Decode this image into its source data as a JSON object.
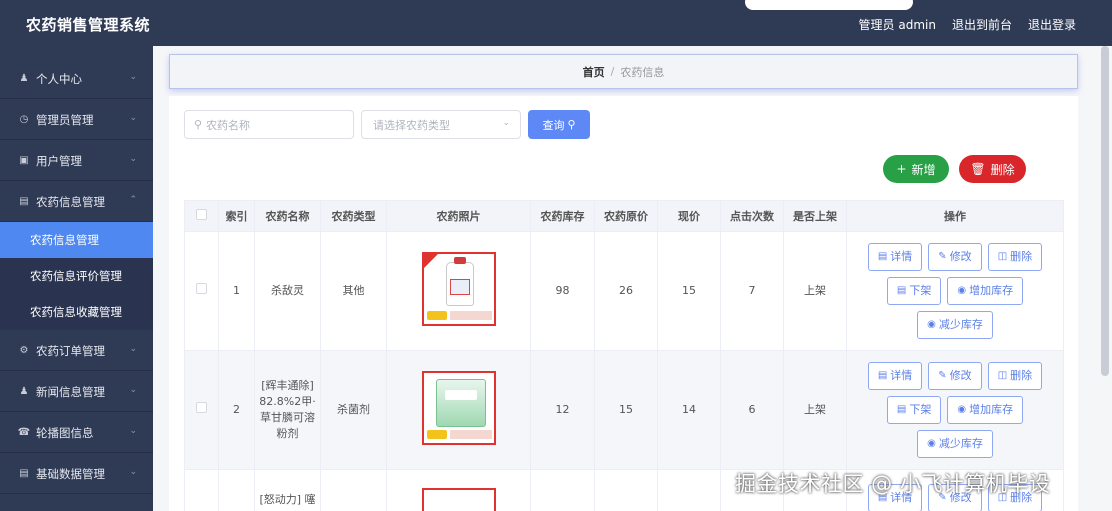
{
  "app": {
    "title": "农药销售管理系统"
  },
  "header": {
    "user_label": "管理员 admin",
    "links": [
      "退出到前台",
      "退出登录"
    ]
  },
  "sidebar": {
    "items": [
      {
        "label": "个人中心",
        "icon": "person-icon"
      },
      {
        "label": "管理员管理",
        "icon": "clock-icon"
      },
      {
        "label": "用户管理",
        "icon": "users-icon"
      },
      {
        "label": "农药信息管理",
        "icon": "doc-icon",
        "expanded": true,
        "children": [
          "农药信息管理",
          "农药信息评价管理",
          "农药信息收藏管理"
        ],
        "active_child": 0
      },
      {
        "label": "农药订单管理",
        "icon": "gear-icon"
      },
      {
        "label": "新闻信息管理",
        "icon": "person-icon"
      },
      {
        "label": "轮播图信息",
        "icon": "mic-icon"
      },
      {
        "label": "基础数据管理",
        "icon": "doc-icon"
      }
    ]
  },
  "breadcrumb": {
    "home": "首页",
    "sep": "/",
    "current": "农药信息"
  },
  "search": {
    "name_placeholder": "农药名称",
    "type_placeholder": "请选择农药类型",
    "query_label": "查询"
  },
  "actions": {
    "add_label": "新增",
    "delete_label": "删除"
  },
  "table": {
    "headers": [
      "索引",
      "农药名称",
      "农药类型",
      "农药照片",
      "农药库存",
      "农药原价",
      "现价",
      "点击次数",
      "是否上架",
      "操作"
    ],
    "rows": [
      {
        "index": "1",
        "name": "杀敌灵",
        "type": "其他",
        "stock": "98",
        "original_price": "26",
        "price": "15",
        "clicks": "7",
        "status": "上架"
      },
      {
        "index": "2",
        "name": "[辉丰通除] 82.8%2甲·草甘膦可溶粉剂",
        "type": "杀菌剂",
        "stock": "12",
        "original_price": "15",
        "price": "14",
        "clicks": "6",
        "status": "上架"
      },
      {
        "index": "",
        "name": "[怒动力] 噻",
        "type": "",
        "stock": "",
        "original_price": "",
        "price": "",
        "clicks": "",
        "status": ""
      }
    ],
    "row_ops": {
      "detail": "详情",
      "edit": "修改",
      "delete": "删除",
      "off_shelf": "下架",
      "add_stock": "增加库存",
      "reduce_stock": "减少库存"
    }
  },
  "watermark": "掘金技术社区 @ 小飞计算机毕设",
  "colors": {
    "sidebar_bg": "#2f3a55",
    "active_menu": "#4e88f0",
    "primary": "#5e88f6",
    "success": "#27a046",
    "danger": "#d8262b"
  }
}
